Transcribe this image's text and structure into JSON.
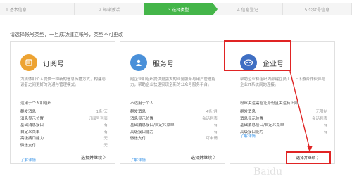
{
  "steps": [
    {
      "label": "1 基本信息",
      "active": false
    },
    {
      "label": "2 邮箱激活",
      "active": false
    },
    {
      "label": "3 选择类型",
      "active": true
    },
    {
      "label": "4 信息登记",
      "active": false
    },
    {
      "label": "5 公众号信息",
      "active": false
    }
  ],
  "intro": "请选择帐号类型，一旦成功建立帐号，类型不可更改",
  "colors": {
    "accent": "#44b549",
    "subscription": "#eda332",
    "service": "#4a90d9",
    "enterprise": "#3f6fc3",
    "highlight": "#e02424",
    "link": "#459ae9"
  },
  "cards": [
    {
      "title": "订阅号",
      "icon": "subscription-icon",
      "desc": "为媒体和个人提供一种新的信息传播方式，构建与读者之间更好的沟通与管理模式。",
      "fit": "适用于个人和组织",
      "features": [
        {
          "name": "群发消息",
          "value": "1条/天"
        },
        {
          "name": "消息显示位置",
          "value": "订阅号列表"
        },
        {
          "name": "基础消息接口",
          "value": "有"
        },
        {
          "name": "自定义菜单",
          "value": "有"
        },
        {
          "name": "高级接口能力",
          "value": "无"
        },
        {
          "name": "微信支付",
          "value": "无"
        }
      ],
      "more": "了解详情",
      "button": "选择并继续 〉"
    },
    {
      "title": "服务号",
      "icon": "service-icon",
      "desc": "给企业和组织提供更强大的业务服务与用户管理能力，帮助企业快速实现全新的公众号服务平台。",
      "fit": "不适用于个人",
      "features": [
        {
          "name": "群发消息",
          "value": "4条/月"
        },
        {
          "name": "消息显示位置",
          "value": "会话列表"
        },
        {
          "name": "基础消息接口/自定义菜单",
          "value": "有"
        },
        {
          "name": "高级接口能力",
          "value": "有"
        },
        {
          "name": "微信支付",
          "value": "可申请"
        }
      ],
      "more": "了解详情",
      "button": "选择并继续 〉"
    },
    {
      "title": "企业号",
      "icon": "enterprise-icon",
      "desc": "帮助企业和组织内部建立员工、上下游合作伙伴与企业IT系统间的连接。",
      "fit": "粉丝关注需验证身份且关注有上限",
      "features": [
        {
          "name": "群发消息",
          "value": "无限制"
        },
        {
          "name": "消息显示位置",
          "value": "会话列表"
        },
        {
          "name": "基础消息接口/自定义菜单",
          "value": "有"
        },
        {
          "name": "高级接口能力",
          "value": "有"
        }
      ],
      "more": "了解详情",
      "button": "选择并继续 〉"
    }
  ],
  "watermark": "Baidu"
}
